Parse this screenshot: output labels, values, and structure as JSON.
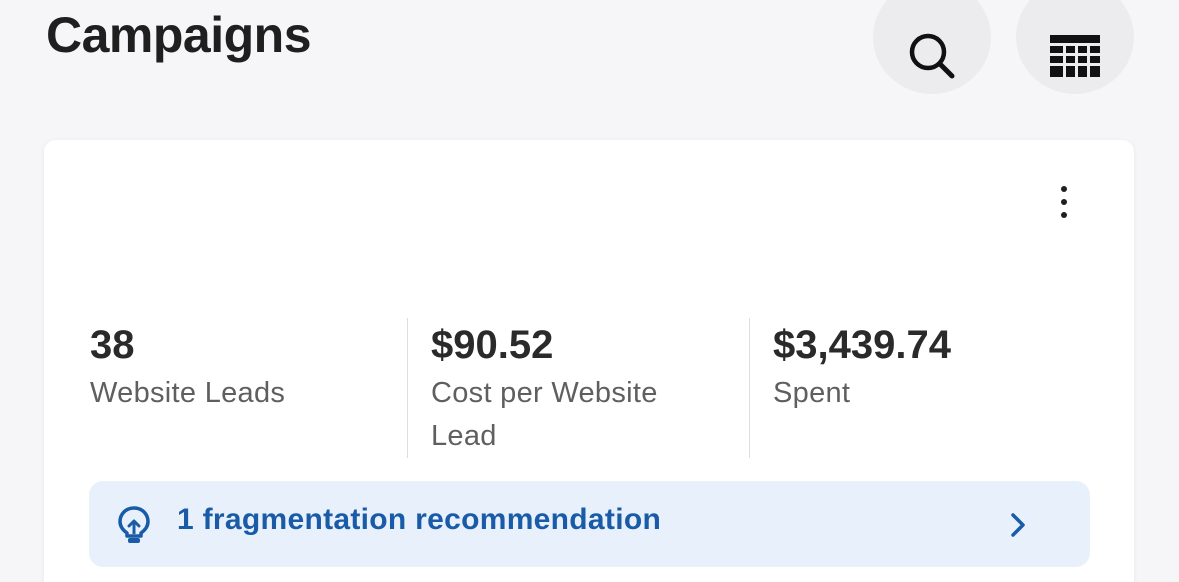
{
  "header": {
    "title": "Campaigns",
    "actions": [
      {
        "name": "search",
        "icon": "search-icon"
      },
      {
        "name": "columns",
        "icon": "table-columns-icon"
      }
    ]
  },
  "card": {
    "more_icon": "more-vertical-icon",
    "metrics": [
      {
        "value": "38",
        "label": "Website Leads"
      },
      {
        "value": "$90.52",
        "label": "Cost per Website Lead"
      },
      {
        "value": "$3,439.74",
        "label": "Spent"
      }
    ],
    "recommendation": {
      "icon": "lightbulb-icon",
      "text": "1 fragmentation recommendation",
      "chevron_icon": "chevron-right-icon",
      "accent": "#1a5ba8",
      "background": "#e8f1fb"
    }
  }
}
